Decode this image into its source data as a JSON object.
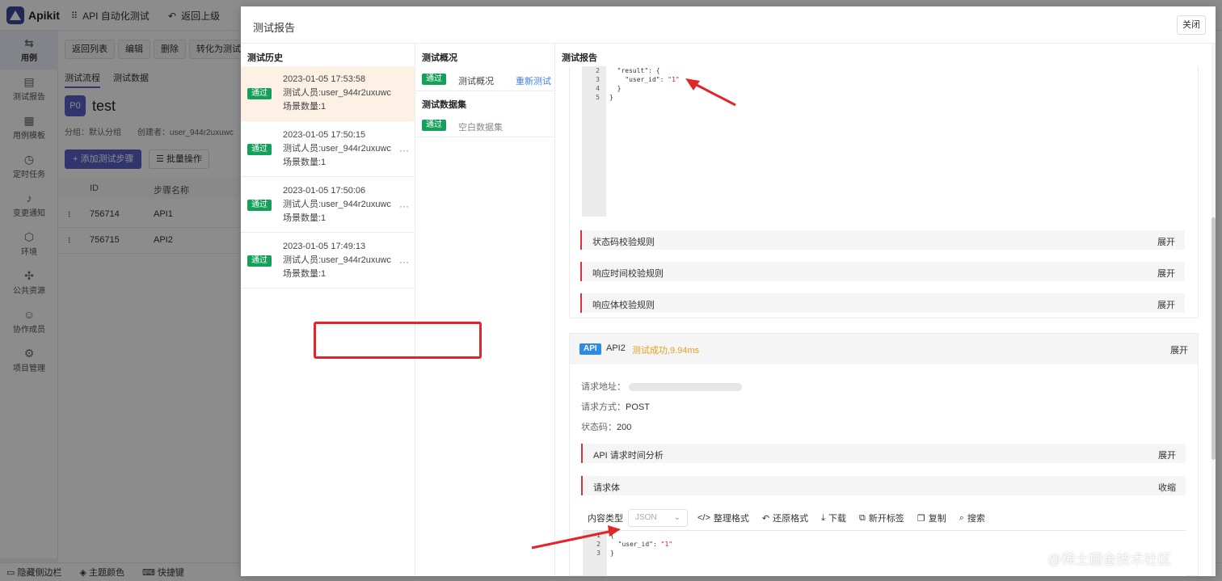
{
  "app": {
    "logo_text": "Apikit",
    "topnav": {
      "project": "API 自动化测试",
      "back": "返回上级"
    }
  },
  "sidebar": {
    "items": [
      {
        "label": "用例",
        "icon": "swap-icon"
      },
      {
        "label": "测试报告",
        "icon": "report-icon"
      },
      {
        "label": "用例模板",
        "icon": "template-icon"
      },
      {
        "label": "定时任务",
        "icon": "clock-icon"
      },
      {
        "label": "变更通知",
        "icon": "bell-icon"
      },
      {
        "label": "环境",
        "icon": "environment-icon"
      },
      {
        "label": "公共资源",
        "icon": "puzzle-icon"
      },
      {
        "label": "协作成员",
        "icon": "members-icon"
      },
      {
        "label": "项目管理",
        "icon": "gear-icon"
      }
    ]
  },
  "bottombar": {
    "hide_sidebar": "隐藏侧边栏",
    "theme": "主题颜色",
    "shortcuts": "快捷键"
  },
  "case": {
    "buttons": {
      "back_list": "返回列表",
      "edit": "编辑",
      "delete": "删除",
      "convert": "转化为测试"
    },
    "tabs": {
      "flow": "测试流程",
      "data": "测试数据"
    },
    "badge": "P0",
    "title": "test",
    "meta": {
      "group": "分组：默认分组",
      "creator": "创建者：user_944r2uxuwc"
    },
    "add_step": "添加测试步骤",
    "batch": "批量操作",
    "table": {
      "headers": [
        "ID",
        "步骤名称"
      ],
      "rows": [
        {
          "id": "756714",
          "name": "API1"
        },
        {
          "id": "756715",
          "name": "API2"
        }
      ]
    }
  },
  "modal": {
    "title": "测试报告",
    "close": "关闭",
    "history": {
      "title": "测试历史",
      "items": [
        {
          "status": "通过",
          "time": "2023-01-05 17:53:58",
          "tester": "测试人员:user_944r2uxuwc",
          "count": "场景数量:1"
        },
        {
          "status": "通过",
          "time": "2023-01-05 17:50:15",
          "tester": "测试人员:user_944r2uxuwc",
          "count": "场景数量:1"
        },
        {
          "status": "通过",
          "time": "2023-01-05 17:50:06",
          "tester": "测试人员:user_944r2uxuwc",
          "count": "场景数量:1"
        },
        {
          "status": "通过",
          "time": "2023-01-05 17:49:13",
          "tester": "测试人员:user_944r2uxuwc",
          "count": "场景数量:1"
        }
      ],
      "more": "···"
    },
    "overview": {
      "title": "测试概况",
      "row_status": "通过",
      "row_label": "测试概况",
      "retest": "重新测试",
      "dataset_title": "测试数据集",
      "dataset_status": "通过",
      "dataset_label": "空白数据集"
    },
    "report": {
      "title": "测试报告",
      "top_code": {
        "line_numbers": [
          "2",
          "3",
          "4",
          "5"
        ],
        "line1": "  \"result\": {",
        "line2_key": "    \"user_id\": ",
        "line2_val": "\"1\"",
        "line3": "  }",
        "line4": "}"
      },
      "rules": [
        {
          "label": "状态码校验规则",
          "action": "展开"
        },
        {
          "label": "响应时间校验规则",
          "action": "展开"
        },
        {
          "label": "响应体校验规则",
          "action": "展开"
        }
      ],
      "api2": {
        "tag": "API",
        "name": "API2",
        "status": "测试成功,9.94ms",
        "expand": "展开",
        "url_label": "请求地址：",
        "method_label": "请求方式：",
        "method": "POST",
        "code_label": "状态码：",
        "code": "200",
        "timing": {
          "label": "API 请求时间分析",
          "action": "展开"
        },
        "body": {
          "label": "请求体",
          "action": "收缩"
        },
        "toolbar": {
          "content_type": "内容类型",
          "select": "JSON",
          "format": "整理格式",
          "restore": "还原格式",
          "download": "下载",
          "new_tab": "新开标签",
          "copy": "复制",
          "search": "搜索"
        },
        "body_code": {
          "line_numbers": [
            "1",
            "2",
            "3"
          ],
          "line1": "{",
          "line2_key": "  \"user_id\": ",
          "line2_val": "\"1\"",
          "line3": "}"
        }
      }
    }
  },
  "watermark": "@稀土掘金技术社区",
  "colors": {
    "pass": "#14a05a",
    "accent": "#5b5fc7",
    "success_text": "#e5a01d",
    "annotation": "#e0262a"
  }
}
